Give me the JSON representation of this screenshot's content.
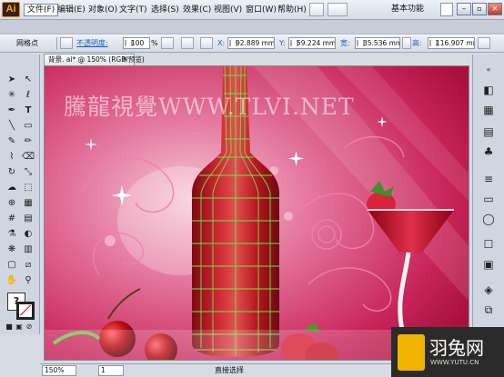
{
  "app": {
    "logo": "Ai"
  },
  "menu": {
    "items": [
      "文件(F)",
      "编辑(E)",
      "对象(O)",
      "文字(T)",
      "选择(S)",
      "效果(C)",
      "视图(V)",
      "窗口(W)",
      "帮助(H)"
    ],
    "workspace": "基本功能"
  },
  "control": {
    "object_type": "网格点",
    "opacity_label": "不透明度:",
    "opacity_value": "100",
    "opacity_unit": "%",
    "x_label": "X:",
    "x_value": "92.889 mm",
    "y_label": "Y:",
    "y_value": "59.224 mm",
    "w_label": "宽:",
    "w_value": "35.536 mm",
    "h_label": "高:",
    "h_value": "116.907 mm"
  },
  "document": {
    "tab_title": "背景. ai* @ 150% (RGB/预览)",
    "tab_close": "×",
    "watermark": "騰龍視覺WWW.TLVI.NET"
  },
  "status": {
    "zoom": "150%",
    "page": "1",
    "tool_name": "直接选择"
  },
  "brand": {
    "name": "羽兔网",
    "url": "WWW.YUTU.CN"
  },
  "colors": {
    "background_pink": "#d23a6a",
    "bottle_red": "#b3161f",
    "mesh_green": "#6fe24a",
    "accent_blue": "#1f5fbf"
  }
}
